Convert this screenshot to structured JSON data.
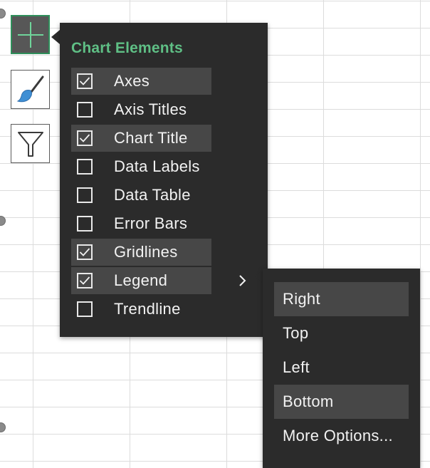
{
  "side_buttons": [
    {
      "icon": "plus-icon",
      "active": true
    },
    {
      "icon": "paintbrush-icon",
      "active": false
    },
    {
      "icon": "funnel-icon",
      "active": false
    }
  ],
  "chart_elements": {
    "title": "Chart Elements",
    "items": [
      {
        "label": "Axes",
        "checked": true
      },
      {
        "label": "Axis Titles",
        "checked": false
      },
      {
        "label": "Chart Title",
        "checked": true
      },
      {
        "label": "Data Labels",
        "checked": false
      },
      {
        "label": "Data Table",
        "checked": false
      },
      {
        "label": "Error Bars",
        "checked": false
      },
      {
        "label": "Gridlines",
        "checked": true
      },
      {
        "label": "Legend",
        "checked": true
      },
      {
        "label": "Trendline",
        "checked": false
      }
    ]
  },
  "legend_submenu": {
    "items": [
      {
        "label": "Right",
        "highlighted": true
      },
      {
        "label": "Top",
        "highlighted": false
      },
      {
        "label": "Left",
        "highlighted": false
      },
      {
        "label": "Bottom",
        "highlighted": true
      },
      {
        "label": "More Options..."
      }
    ]
  },
  "colors": {
    "panel_bg": "#2b2b2b",
    "highlight_bg": "#474747",
    "title_green": "#5fbf85",
    "active_button_border": "#2f8f5b"
  }
}
